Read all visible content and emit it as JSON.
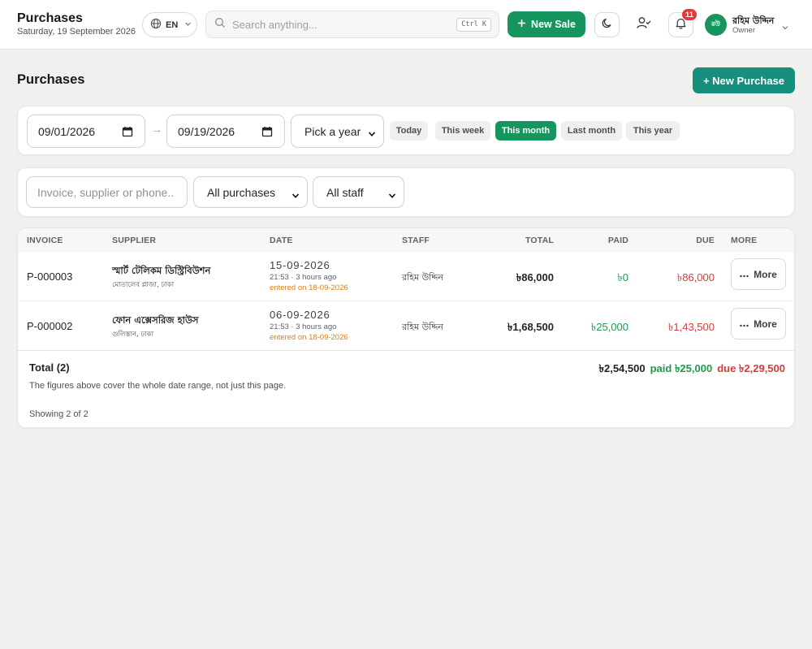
{
  "header": {
    "title": "Purchases",
    "date": "Saturday, 19 September 2026",
    "language": "EN",
    "search_placeholder": "Search anything...",
    "search_shortcut": "Ctrl K",
    "new_sale_label": "New Sale",
    "notification_count": "11",
    "user": {
      "initials": "রউ",
      "name": "রহিম উদ্দিন",
      "role": "Owner"
    }
  },
  "page": {
    "title": "Purchases",
    "new_purchase_label": "+ New Purchase"
  },
  "date_filter": {
    "from": "09/01/2026",
    "to": "09/19/2026",
    "arrow": "→",
    "year_select": "Pick a year",
    "chips": [
      "Today",
      "This week",
      "This month",
      "Last month",
      "This year"
    ],
    "active_chip": "This month"
  },
  "filters": {
    "search_placeholder": "Invoice, supplier or phone..",
    "type_select": "All purchases",
    "staff_select": "All staff"
  },
  "table": {
    "columns": [
      "INVOICE",
      "SUPPLIER",
      "DATE",
      "STAFF",
      "TOTAL",
      "PAID",
      "DUE",
      "MORE"
    ],
    "rows": [
      {
        "invoice": "P-000003",
        "supplier": "স্মার্ট টেলিকম ডিস্ট্রিবিউশন",
        "supplier_address": "মোতালেব প্লাজা, ঢাকা",
        "date": "15-09-2026",
        "time": "21:53 · 3 hours ago",
        "entered": "entered on 18-09-2026",
        "staff": "রহিম উদ্দিন",
        "total": "৳86,000",
        "paid": "৳0",
        "due": "৳86,000",
        "more_label": "More"
      },
      {
        "invoice": "P-000002",
        "supplier": "ফোন এক্সেসরিজ হাউস",
        "supplier_address": "গুলিস্তান, ঢাকা",
        "date": "06-09-2026",
        "time": "21:53 · 3 hours ago",
        "entered": "entered on 18-09-2026",
        "staff": "রহিম উদ্দিন",
        "total": "৳1,68,500",
        "paid": "৳25,000",
        "due": "৳1,43,500",
        "more_label": "More"
      }
    ],
    "footer": {
      "total_label": "Total (2)",
      "total": "৳2,54,500",
      "paid": "paid ৳25,000",
      "due": "due ৳2,29,500",
      "note": "The figures above cover the whole date range, not just this page.",
      "showing": "Showing 2 of 2"
    }
  },
  "colors": {
    "primary_green": "#16965e",
    "teal": "#178f7c",
    "paid_green": "#1c9a4f",
    "due_red": "#d93a3a",
    "entered_orange": "#dd7f0b"
  }
}
